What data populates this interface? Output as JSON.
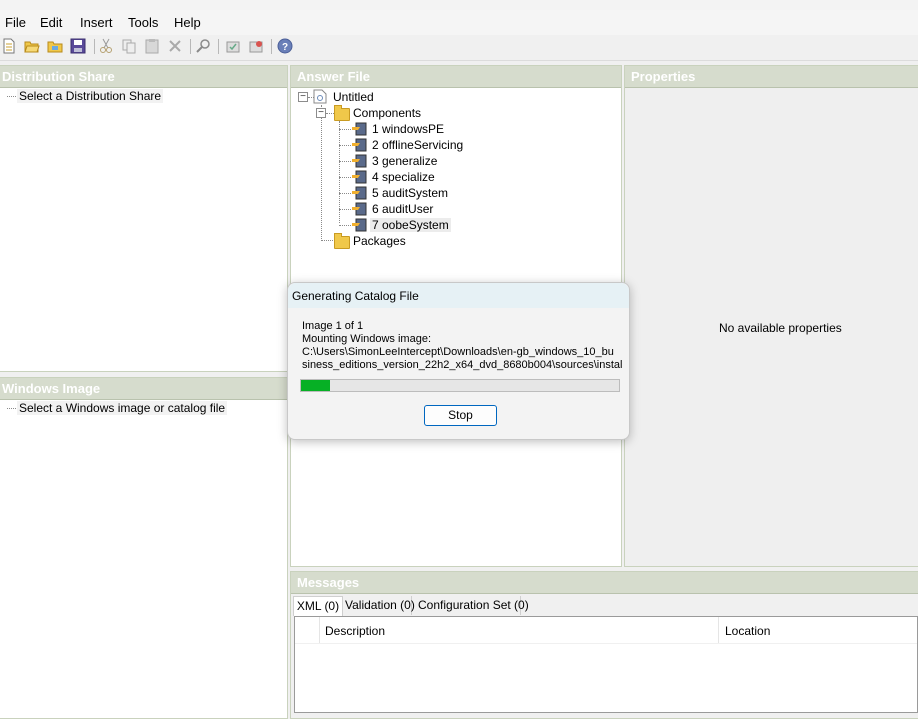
{
  "menu": [
    "File",
    "Edit",
    "Insert",
    "Tools",
    "Help"
  ],
  "toolbar": {
    "buttons": [
      "new-answer-file-icon",
      "open-icon",
      "open-folder-icon",
      "save-icon",
      "cut-icon",
      "copy-icon",
      "paste-icon",
      "delete-icon",
      "find-icon",
      "validate-icon",
      "create-configuration-set-icon",
      "help-icon"
    ]
  },
  "panes": {
    "distribution_share": {
      "title": "Distribution Share",
      "placeholder": "Select a Distribution Share"
    },
    "windows_image": {
      "title": "Windows Image",
      "placeholder": "Select a Windows image or catalog file"
    },
    "answer_file": {
      "title": "Answer File",
      "root": "Untitled",
      "components_label": "Components",
      "passes": [
        "1 windowsPE",
        "2 offlineServicing",
        "3 generalize",
        "4 specialize",
        "5 auditSystem",
        "6 auditUser",
        "7 oobeSystem"
      ],
      "packages_label": "Packages"
    },
    "properties": {
      "title": "Properties",
      "empty": "No available properties"
    },
    "messages": {
      "title": "Messages",
      "tabs": [
        "XML (0)",
        "Validation (0)",
        "Configuration Set (0)"
      ],
      "columns": [
        "Description",
        "Location"
      ]
    }
  },
  "dialog": {
    "title": "Generating Catalog File",
    "line1": "Image 1 of 1",
    "line2": "Mounting Windows image:",
    "line3": "C:\\Users\\SimonLeeIntercept\\Downloads\\en-gb_windows_10_bu",
    "line4": "siness_editions_version_22h2_x64_dvd_8680b004\\sources\\instal",
    "progress": 0.09,
    "stop_label": "Stop"
  },
  "colors": {
    "progress": "#06b025",
    "pane_header": "#d6dccd",
    "accent": "#0067c0"
  }
}
